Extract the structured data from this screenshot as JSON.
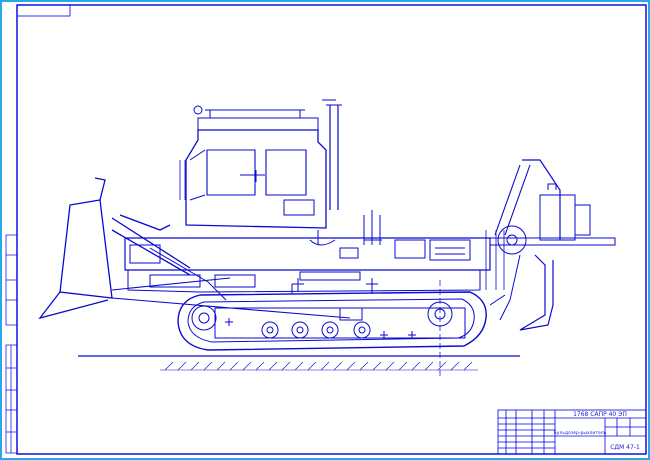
{
  "drawing": {
    "title_block": {
      "document_code": "1768 САПР 40 ЭП",
      "part_name": "Бульдозер-рыхлитель",
      "sheet_code": "СДМ 47-1"
    },
    "colors": {
      "background": "#ffffff",
      "frame": "#0000e6",
      "outer_border": "#2ba7e6",
      "line": "#0a0ad0"
    },
    "subject": "bulldozer-ripper-side-view"
  }
}
